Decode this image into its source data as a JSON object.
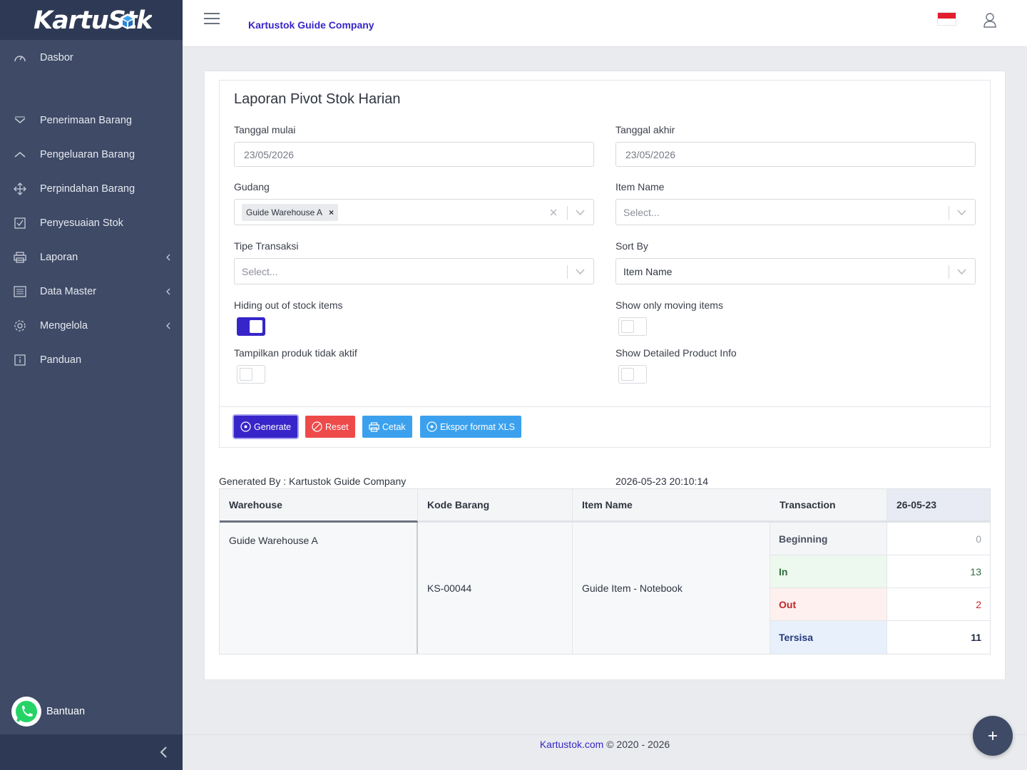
{
  "brand": {
    "name": "KartuStok"
  },
  "sidebar": {
    "items": [
      {
        "label": "Dasbor",
        "icon": "dashboard-icon"
      },
      {
        "label": "Penerimaan Barang",
        "icon": "chevron-down-icon"
      },
      {
        "label": "Pengeluaran Barang",
        "icon": "chevron-up-icon"
      },
      {
        "label": "Perpindahan Barang",
        "icon": "move-arrows-icon"
      },
      {
        "label": "Penyesuaian Stok",
        "icon": "checkbox-icon"
      },
      {
        "label": "Laporan",
        "icon": "printer-icon"
      },
      {
        "label": "Data Master",
        "icon": "list-icon"
      },
      {
        "label": "Mengelola",
        "icon": "gear-icon"
      },
      {
        "label": "Panduan",
        "icon": "info-icon"
      }
    ],
    "help_label": "Bantuan"
  },
  "header": {
    "company": "Kartustok Guide Company"
  },
  "report": {
    "title": "Laporan Pivot Stok Harian",
    "start_date_label": "Tanggal mulai",
    "start_date_value": "23/05/2026",
    "end_date_label": "Tanggal akhir",
    "end_date_value": "23/05/2026",
    "warehouse_label": "Gudang",
    "warehouse_selected": "Guide Warehouse A",
    "item_name_label": "Item Name",
    "item_name_placeholder": "Select...",
    "tx_type_label": "Tipe Transaksi",
    "tx_type_placeholder": "Select...",
    "sort_by_label": "Sort By",
    "sort_by_value": "Item Name",
    "toggle_hide_oos_label": "Hiding out of stock items",
    "toggle_hide_oos_on": true,
    "toggle_moving_label": "Show only moving items",
    "toggle_moving_on": false,
    "toggle_inactive_label": "Tampilkan produk tidak aktif",
    "toggle_inactive_on": false,
    "toggle_detail_label": "Show Detailed Product Info",
    "toggle_detail_on": false,
    "buttons": {
      "generate": "Generate",
      "reset": "Reset",
      "print": "Cetak",
      "export": "Ekspor format XLS"
    },
    "generated_by": "Generated By : Kartustok Guide Company",
    "generated_at": "2026-05-23 20:10:14"
  },
  "table": {
    "headers": {
      "warehouse": "Warehouse",
      "code": "Kode Barang",
      "item": "Item Name",
      "transaction": "Transaction",
      "date": "26-05-23"
    },
    "row": {
      "warehouse": "Guide Warehouse A",
      "code": "KS-00044",
      "item": "Guide Item - Notebook",
      "transactions": [
        {
          "label": "Beginning",
          "value": "0"
        },
        {
          "label": "In",
          "value": "13"
        },
        {
          "label": "Out",
          "value": "2"
        },
        {
          "label": "Tersisa",
          "value": "11"
        }
      ]
    }
  },
  "footer": {
    "link": "Kartustok.com",
    "copyright": "© 2020 - 2026"
  },
  "colors": {
    "primary": "#3725c9",
    "sidebar": "#3e4a66",
    "danger": "#ee4a4a",
    "info": "#3ba1ee"
  }
}
